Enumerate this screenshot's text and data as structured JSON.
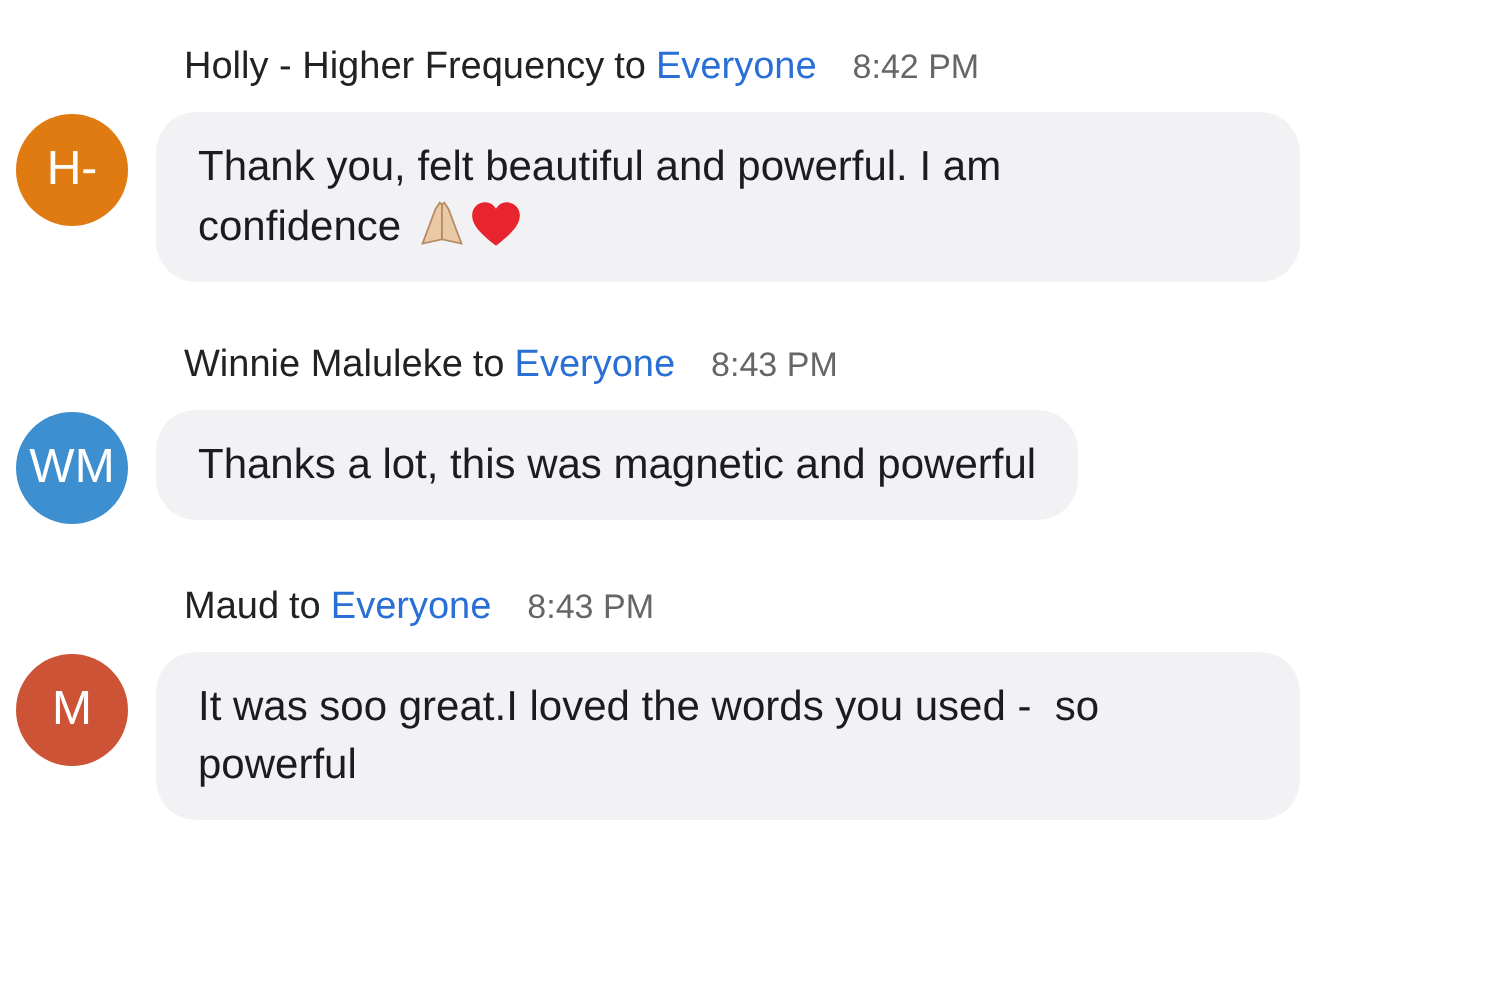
{
  "messages": [
    {
      "avatar": {
        "initials": "H-",
        "color": "#e07b12"
      },
      "sender": "Holly - Higher Frequency",
      "to": "to",
      "recipient": "Everyone",
      "time": "8:42 PM",
      "text": "Thank you, felt beautiful and powerful. I am confidence",
      "emoji": [
        {
          "kind": "praying-hands"
        },
        {
          "kind": "heart"
        }
      ]
    },
    {
      "avatar": {
        "initials": "WM",
        "color": "#3d8fd0"
      },
      "sender": "Winnie Maluleke",
      "to": "to",
      "recipient": "Everyone",
      "time": "8:43 PM",
      "text": "Thanks a lot, this was magnetic and powerful"
    },
    {
      "avatar": {
        "initials": "M",
        "color": "#cc5336"
      },
      "sender": "Maud",
      "to": "to",
      "recipient": "Everyone",
      "time": "8:43 PM",
      "text": "It was soo great.I loved the words you used -  so powerful"
    }
  ]
}
